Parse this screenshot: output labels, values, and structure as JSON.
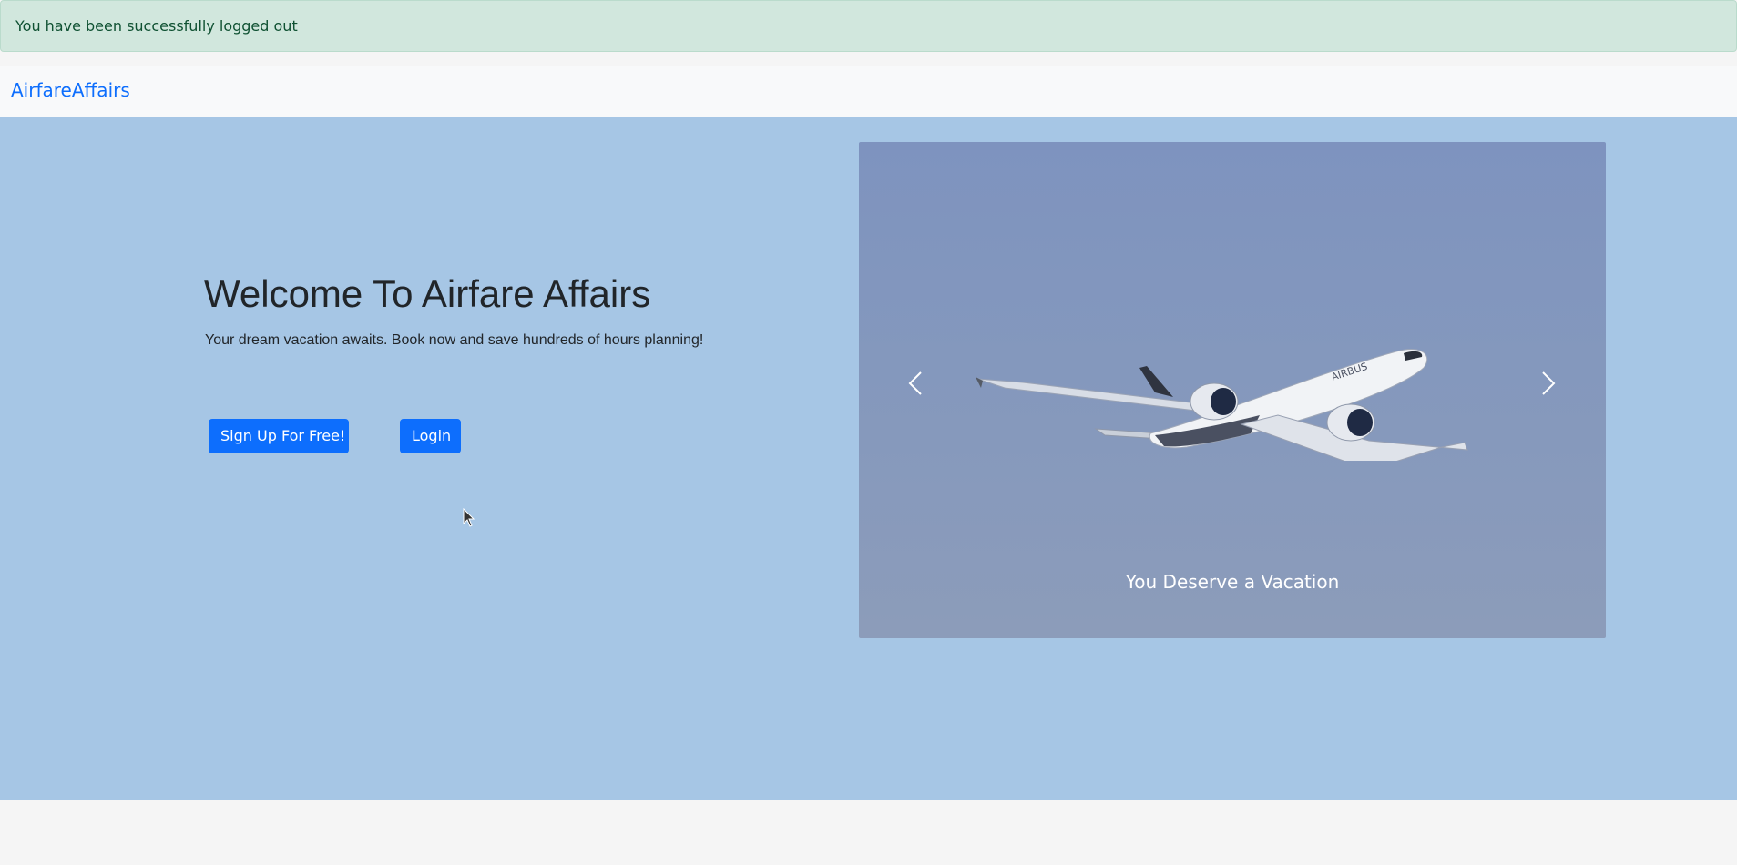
{
  "alert": {
    "message": "You have been successfully logged out",
    "color": "#d1e7dd"
  },
  "navbar": {
    "brand": "AirfareAffairs"
  },
  "hero": {
    "title": "Welcome To Airfare Affairs",
    "subtitle": "Your dream vacation awaits. Book now and save hundreds of hours planning!",
    "signup_label": "Sign Up For Free!",
    "login_label": "Login",
    "background": "#a6c6e5",
    "accent": "#0d6efd"
  },
  "carousel": {
    "caption": "You Deserve a Vacation",
    "prev_icon": "chevron-left-icon",
    "next_icon": "chevron-right-icon",
    "image": "airplane"
  }
}
